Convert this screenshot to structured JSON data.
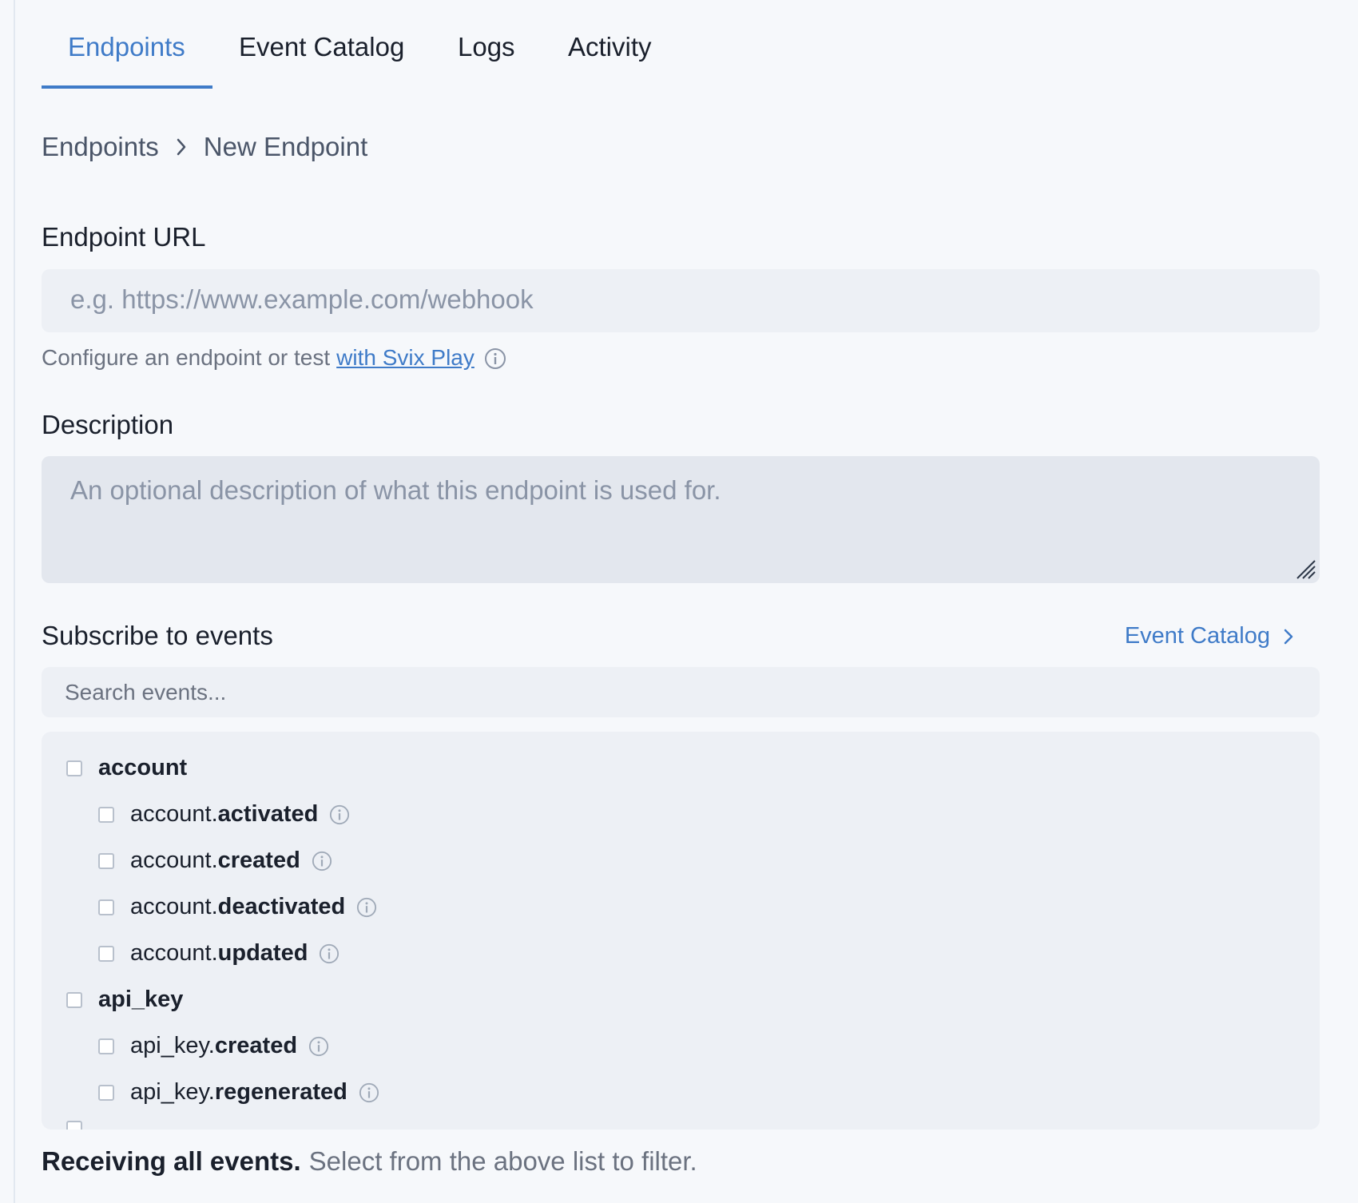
{
  "tabs": [
    {
      "label": "Endpoints",
      "active": true
    },
    {
      "label": "Event Catalog",
      "active": false
    },
    {
      "label": "Logs",
      "active": false
    },
    {
      "label": "Activity",
      "active": false
    }
  ],
  "breadcrumb": {
    "parent": "Endpoints",
    "current": "New Endpoint"
  },
  "form": {
    "url_label": "Endpoint URL",
    "url_placeholder": "e.g. https://www.example.com/webhook",
    "help_text": "Configure an endpoint or test",
    "help_link": "with Svix Play",
    "description_label": "Description",
    "description_placeholder": "An optional description of what this endpoint is used for."
  },
  "events": {
    "title": "Subscribe to events",
    "catalog_link": "Event Catalog",
    "search_placeholder": "Search events...",
    "groups": [
      {
        "name": "account",
        "items": [
          {
            "prefix": "account.",
            "suffix": "activated"
          },
          {
            "prefix": "account.",
            "suffix": "created"
          },
          {
            "prefix": "account.",
            "suffix": "deactivated"
          },
          {
            "prefix": "account.",
            "suffix": "updated"
          }
        ]
      },
      {
        "name": "api_key",
        "items": [
          {
            "prefix": "api_key.",
            "suffix": "created"
          },
          {
            "prefix": "api_key.",
            "suffix": "regenerated"
          }
        ]
      }
    ]
  },
  "footer": {
    "strong": "Receiving all events.",
    "muted": "Select from the above list to filter."
  },
  "colors": {
    "accent": "#3f7bc8",
    "background": "#f6f8fb",
    "input_bg": "#edf0f5"
  }
}
